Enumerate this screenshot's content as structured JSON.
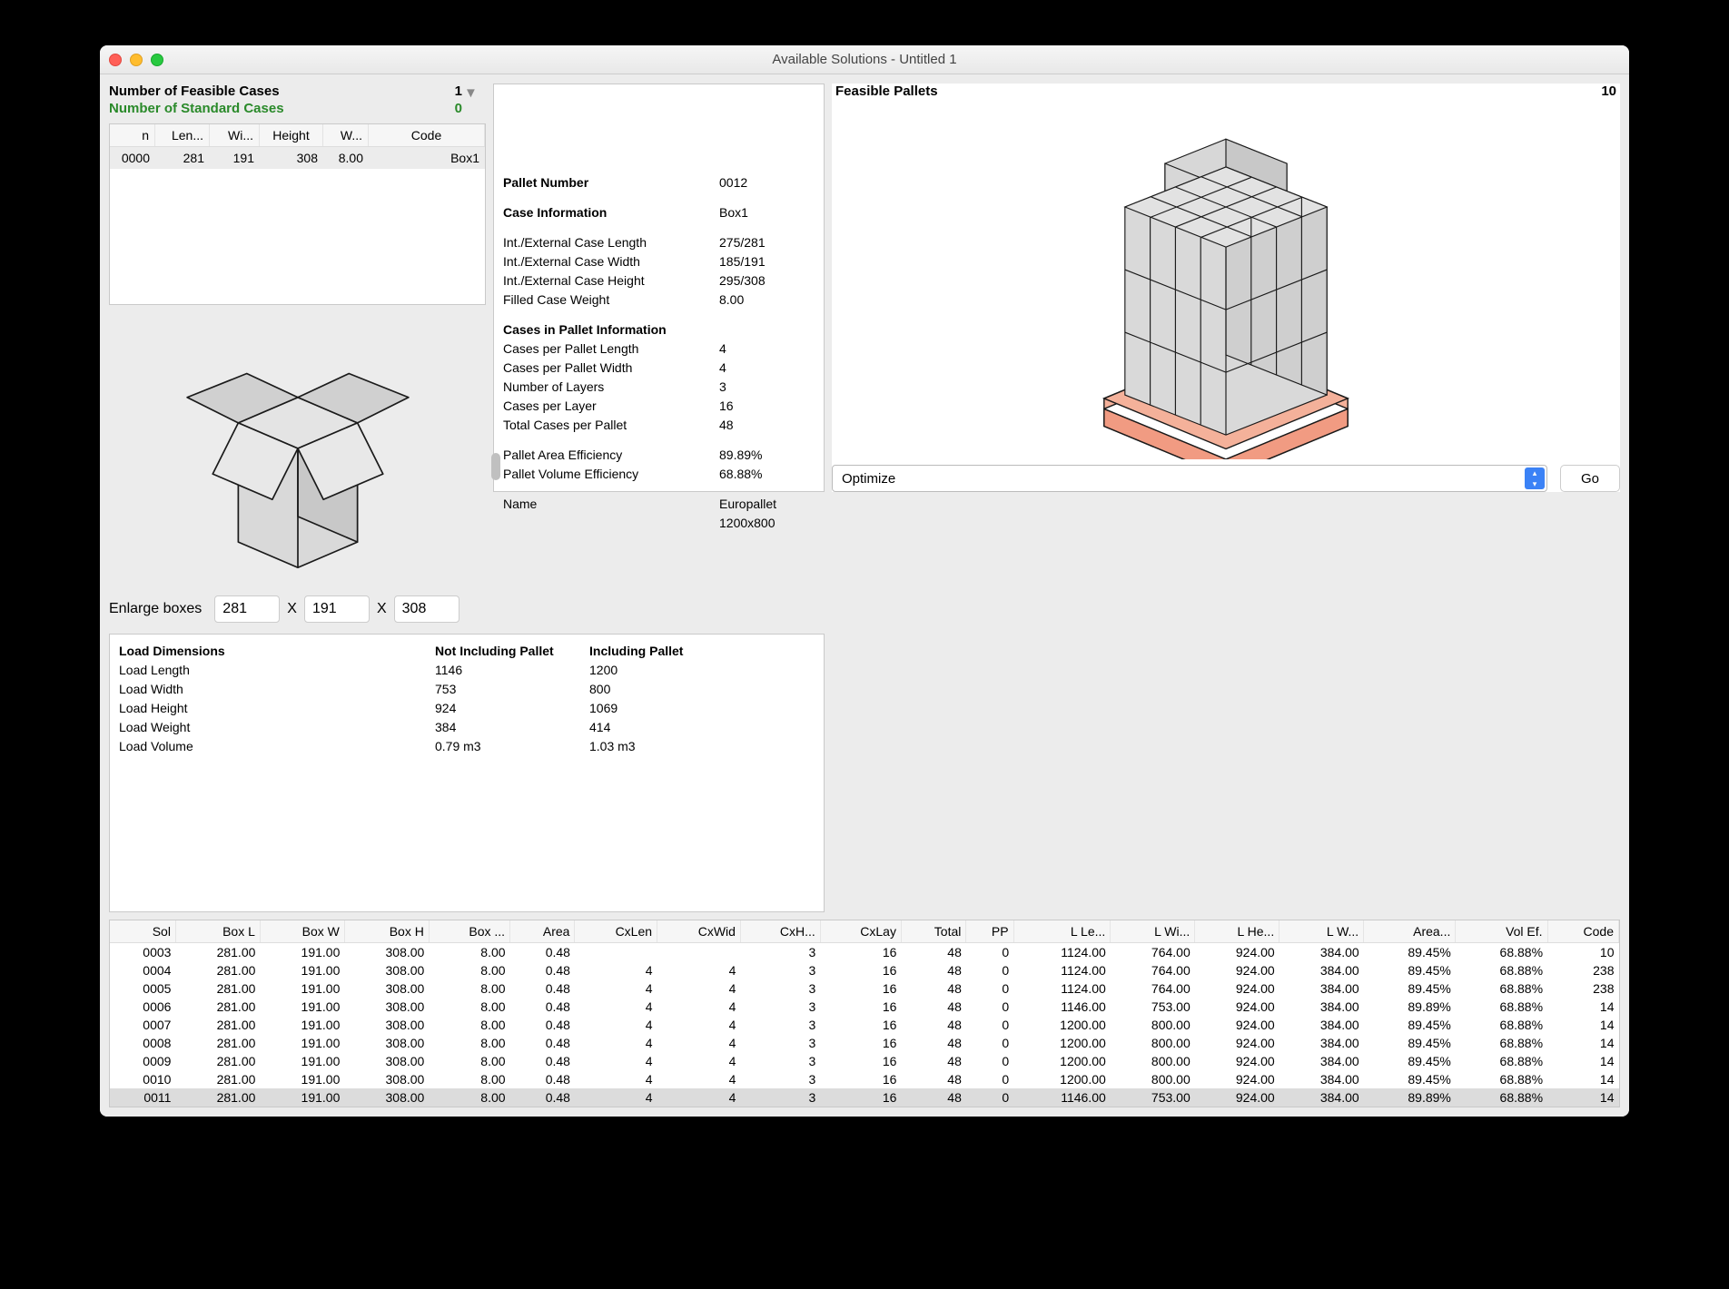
{
  "window": {
    "title": "Available Solutions - Untitled 1"
  },
  "pallet_info": {
    "pallet_number_label": "Pallet Number",
    "pallet_number": "0012",
    "case_info_label": "Case Information",
    "case_info": "Box1",
    "int_ext_len_label": "Int./External Case Length",
    "int_ext_len": "275/281",
    "int_ext_wid_label": "Int./External Case Width",
    "int_ext_wid": "185/191",
    "int_ext_hgt_label": "Int./External Case Height",
    "int_ext_hgt": "295/308",
    "filled_wt_label": "Filled Case Weight",
    "filled_wt": "8.00",
    "cases_in_pallet_label": "Cases in Pallet Information",
    "cpl_len_label": "Cases per Pallet Length",
    "cpl_len": "4",
    "cpl_wid_label": "Cases per Pallet Width",
    "cpl_wid": "4",
    "layers_label": "Number of Layers",
    "layers": "3",
    "cpl_label": "Cases per Layer",
    "cpl": "16",
    "total_label": "Total Cases per Pallet",
    "total": "48",
    "area_eff_label": "Pallet Area Efficiency",
    "area_eff": "89.89%",
    "vol_eff_label": "Pallet Volume Efficiency",
    "vol_eff": "68.88%",
    "name_label": "Name",
    "name": "Europallet 1200x800"
  },
  "feasible": {
    "label": "Feasible Pallets",
    "count": "10"
  },
  "action": {
    "select": "Optimize",
    "go": "Go"
  },
  "cases_hdr": {
    "feasible_label": "Number of Feasible Cases",
    "feasible_count": "1",
    "standard_label": "Number of Standard Cases",
    "standard_count": "0"
  },
  "cases_table": {
    "cols": {
      "n": "n",
      "len": "Len...",
      "wi": "Wi...",
      "h": "Height",
      "w": "W...",
      "code": "Code"
    },
    "rows": [
      {
        "n": "0000",
        "len": "281",
        "wi": "191",
        "h": "308",
        "w": "8.00",
        "code": "Box1"
      }
    ]
  },
  "enlarge": {
    "label": "Enlarge boxes",
    "l": "281",
    "w": "191",
    "h": "308",
    "x": "X"
  },
  "load": {
    "header_label": "Load Dimensions",
    "not_incl": "Not Including Pallet",
    "incl": "Including Pallet",
    "rows": [
      {
        "label": "Load Length",
        "a": "1146",
        "b": "1200"
      },
      {
        "label": "Load Width",
        "a": "753",
        "b": "800"
      },
      {
        "label": "Load Height",
        "a": "924",
        "b": "1069"
      },
      {
        "label": "Load Weight",
        "a": "384",
        "b": "414"
      },
      {
        "label": "Load Volume",
        "a": "0.79 m3",
        "b": "1.03 m3"
      }
    ]
  },
  "solutions": {
    "cols": [
      "Sol",
      "Box L",
      "Box W",
      "Box H",
      "Box ...",
      "Area",
      "CxLen",
      "CxWid",
      "CxH...",
      "CxLay",
      "Total",
      "PP",
      "L Le...",
      "L Wi...",
      "L He...",
      "L W...",
      "Area...",
      "Vol Ef.",
      "Code"
    ],
    "rows": [
      {
        "sel": false,
        "c": [
          "0003",
          "281.00",
          "191.00",
          "308.00",
          "8.00",
          "0.48",
          "",
          "",
          "3",
          "16",
          "48",
          "0",
          "1124.00",
          "764.00",
          "924.00",
          "384.00",
          "89.45%",
          "68.88%",
          "10"
        ]
      },
      {
        "sel": false,
        "c": [
          "0004",
          "281.00",
          "191.00",
          "308.00",
          "8.00",
          "0.48",
          "4",
          "4",
          "3",
          "16",
          "48",
          "0",
          "1124.00",
          "764.00",
          "924.00",
          "384.00",
          "89.45%",
          "68.88%",
          "238"
        ]
      },
      {
        "sel": false,
        "c": [
          "0005",
          "281.00",
          "191.00",
          "308.00",
          "8.00",
          "0.48",
          "4",
          "4",
          "3",
          "16",
          "48",
          "0",
          "1124.00",
          "764.00",
          "924.00",
          "384.00",
          "89.45%",
          "68.88%",
          "238"
        ]
      },
      {
        "sel": false,
        "c": [
          "0006",
          "281.00",
          "191.00",
          "308.00",
          "8.00",
          "0.48",
          "4",
          "4",
          "3",
          "16",
          "48",
          "0",
          "1146.00",
          "753.00",
          "924.00",
          "384.00",
          "89.89%",
          "68.88%",
          "14"
        ]
      },
      {
        "sel": false,
        "c": [
          "0007",
          "281.00",
          "191.00",
          "308.00",
          "8.00",
          "0.48",
          "4",
          "4",
          "3",
          "16",
          "48",
          "0",
          "1200.00",
          "800.00",
          "924.00",
          "384.00",
          "89.45%",
          "68.88%",
          "14"
        ]
      },
      {
        "sel": false,
        "c": [
          "0008",
          "281.00",
          "191.00",
          "308.00",
          "8.00",
          "0.48",
          "4",
          "4",
          "3",
          "16",
          "48",
          "0",
          "1200.00",
          "800.00",
          "924.00",
          "384.00",
          "89.45%",
          "68.88%",
          "14"
        ]
      },
      {
        "sel": false,
        "c": [
          "0009",
          "281.00",
          "191.00",
          "308.00",
          "8.00",
          "0.48",
          "4",
          "4",
          "3",
          "16",
          "48",
          "0",
          "1200.00",
          "800.00",
          "924.00",
          "384.00",
          "89.45%",
          "68.88%",
          "14"
        ]
      },
      {
        "sel": false,
        "c": [
          "0010",
          "281.00",
          "191.00",
          "308.00",
          "8.00",
          "0.48",
          "4",
          "4",
          "3",
          "16",
          "48",
          "0",
          "1200.00",
          "800.00",
          "924.00",
          "384.00",
          "89.45%",
          "68.88%",
          "14"
        ]
      },
      {
        "sel": true,
        "c": [
          "0011",
          "281.00",
          "191.00",
          "308.00",
          "8.00",
          "0.48",
          "4",
          "4",
          "3",
          "16",
          "48",
          "0",
          "1146.00",
          "753.00",
          "924.00",
          "384.00",
          "89.89%",
          "68.88%",
          "14"
        ]
      }
    ]
  }
}
